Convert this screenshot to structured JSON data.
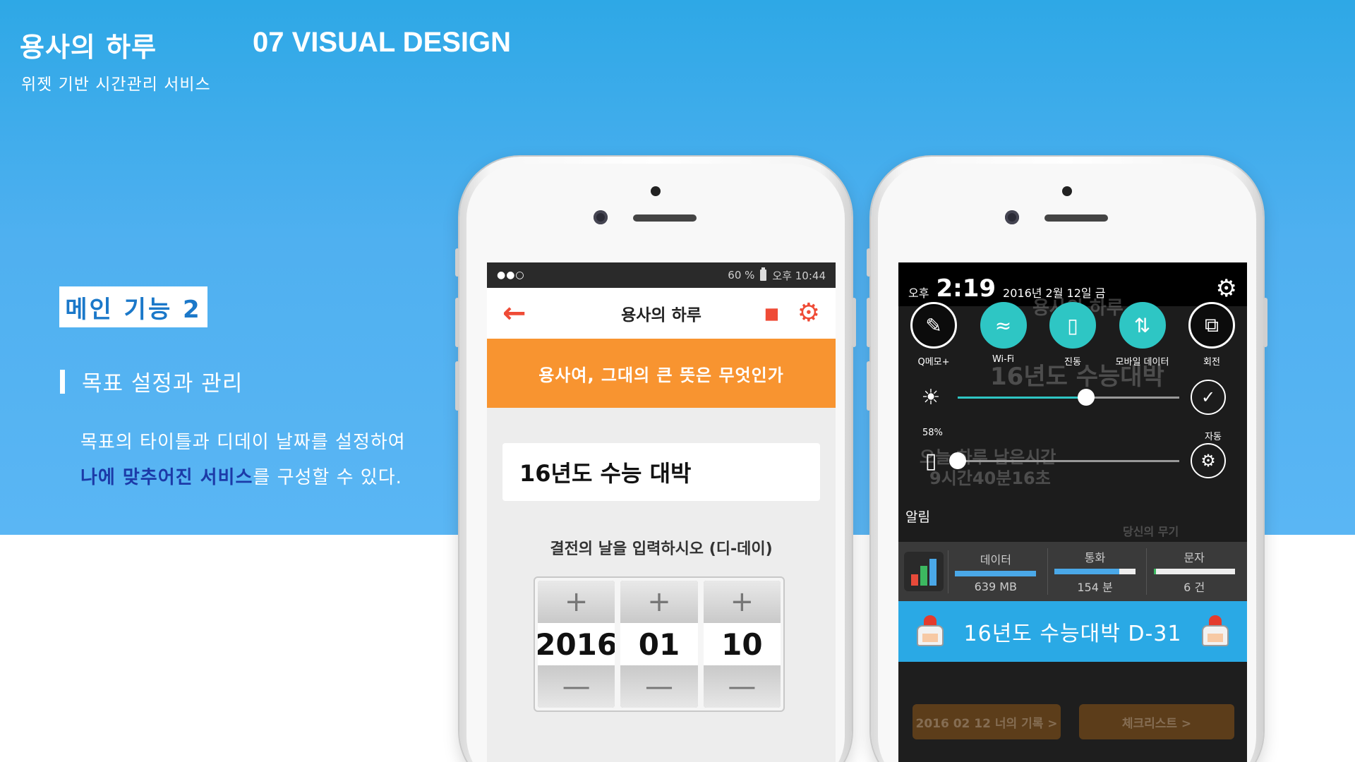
{
  "header": {
    "brand_title": "용사의 하루",
    "brand_subtitle": "위젯 기반 시간관리 서비스",
    "section_title": "07 VISUAL DESIGN"
  },
  "feature": {
    "badge": "메인 기능 2",
    "heading": "목표 설정과 관리",
    "desc_line1": "목표의 타이틀과 디데이 날짜를 설정하여",
    "desc_line2_highlight": "나에 맞추어진 서비스",
    "desc_line2_rest": "를 구성할 수 있다."
  },
  "phone_left": {
    "status": {
      "signal": "●●○",
      "battery": "60 %",
      "time": "오후 10:44"
    },
    "app_title": "용사의 하루",
    "banner": "용사여, 그대의 큰 뜻은 무엇인가",
    "goal_title": "16년도 수능 대박",
    "dday_prompt": "결전의 날을 입력하시오 (디-데이)",
    "picker": {
      "plus": "+",
      "minus": "—",
      "year": "2016",
      "month": "01",
      "day": "10"
    }
  },
  "phone_right": {
    "status": {
      "ampm": "오후",
      "time": "2:19",
      "date": "2016년 2월 12일 금"
    },
    "quick_settings": [
      {
        "label": "Q메모+",
        "icon": "qmemo-icon",
        "on": false
      },
      {
        "label": "Wi-Fi",
        "icon": "wifi-icon",
        "on": true
      },
      {
        "label": "진동",
        "icon": "vibrate-icon",
        "on": true
      },
      {
        "label": "모바일 데이터",
        "icon": "mobile-data-icon",
        "on": true
      },
      {
        "label": "회전",
        "icon": "rotate-icon",
        "on": false
      }
    ],
    "brightness_percent": "58%",
    "brightness_level": 0.58,
    "volume_level": 0.0,
    "auto_label": "자동",
    "alarm_label": "알림",
    "usage": [
      {
        "name": "데이터",
        "value": "639 MB",
        "fill": 1.0,
        "color": "#4aa8e8"
      },
      {
        "name": "통화",
        "value": "154 분",
        "fill": 0.8,
        "color": "#4aa8e8"
      },
      {
        "name": "문자",
        "value": "6 건",
        "fill": 0.03,
        "color": "#3cb860"
      }
    ],
    "widget_text": "16년도  수능대박  D-31",
    "background_ghost": {
      "app_title": "용사의 하루",
      "goal": "16년도 수능대박",
      "remaining_line1": "오늘 하루 남은시간",
      "remaining_line2": "9시간40분16초",
      "weapon_label": "당신의 무기",
      "log_button": "2016 02 12 너의 기록 >",
      "checklist_button": "체크리스트   >"
    }
  },
  "colors": {
    "accent_orange": "#f89430",
    "accent_red": "#ef4b36",
    "widget_blue": "#2aa9e5",
    "toggle_teal": "#2ec6c4",
    "highlight_blue": "#1c3aa8"
  }
}
